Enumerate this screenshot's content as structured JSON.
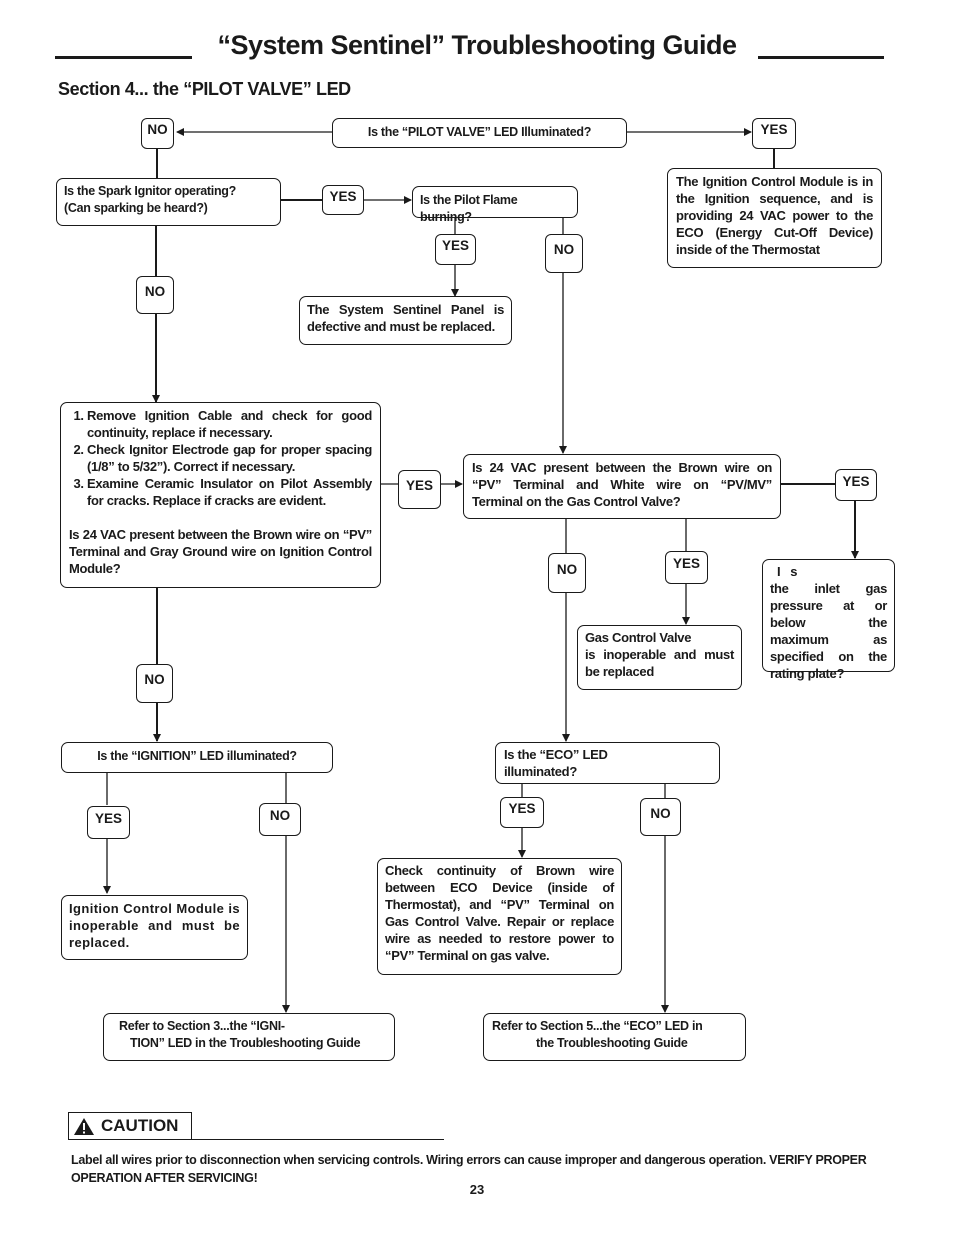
{
  "header": {
    "title": "“System Sentinel” Troubleshooting Guide",
    "section": "Section 4... the “PILOT VALVE” LED"
  },
  "labels": {
    "yes": "YES",
    "no": "NO"
  },
  "flowchart": {
    "q_pilot_valve_led": "Is the “PILOT VALVE” LED Illuminated?",
    "q_spark_ignitor": [
      "Is the Spark Ignitor operating?",
      "(Can sparking be heard?)"
    ],
    "q_pilot_flame": "Is the Pilot Flame burning?",
    "r_ignition_sequence": "The Ignition Control Module is in the Ignition sequence, and is providing 24 VAC power to the ECO (Energy Cut-Off Device) inside of the Thermostat",
    "r_panel_defective": "The System Sentinel Panel is defective and must be replaced.",
    "steps": [
      "Remove Ignition Cable and check for good continuity, replace if necessary.",
      "Check Ignitor Electrode gap for  proper spacing (1/8” to 5/32”). Correct if necessary.",
      "Examine Ceramic Insulator on Pilot Assembly for cracks. Replace if cracks are evident."
    ],
    "q_24vac_ignition_module": "Is 24 VAC present between the Brown wire on “PV” Terminal and Gray Ground wire on Ignition Control Module?",
    "q_24vac_gas_valve": "Is 24 VAC present between the Brown wire on “PV” Terminal and White wire on “PV/MV” Terminal on the Gas Control Valve?",
    "q_inlet_pressure": [
      "I   s",
      "the inlet gas pressure at or below the maximum as specified on the rating plate?"
    ],
    "r_gas_valve_inoperable": [
      "Gas Control Valve",
      "is inoperable and must be replaced"
    ],
    "q_ignition_led": "Is the “IGNITION” LED illuminated?",
    "q_eco_led": [
      "Is the “ECO” LED",
      "illuminated?"
    ],
    "r_icm_inoperable": "Ignition Control Module is inoperable and must be replaced.",
    "r_check_continuity": "Check continuity of Brown wire between ECO Device (inside of Thermostat), and “PV” Terminal on Gas Control Valve. Repair or replace wire as needed to restore power to “PV” Terminal on gas valve.",
    "r_refer_section3": [
      "Refer to Section 3...the “IGNI-",
      "TION” LED in the Troubleshooting Guide"
    ],
    "r_refer_section5": [
      "Refer to Section 5...the “ECO” LED in",
      "the Troubleshooting Guide"
    ]
  },
  "caution": {
    "icon": "warning-triangle-icon",
    "label": "CAUTION",
    "text": "Label all wires prior to disconnection when servicing controls. Wiring errors can cause improper and dangerous operation.   VERIFY PROPER OPERATION AFTER SERVICING!"
  },
  "footer": {
    "page_number": "23"
  }
}
